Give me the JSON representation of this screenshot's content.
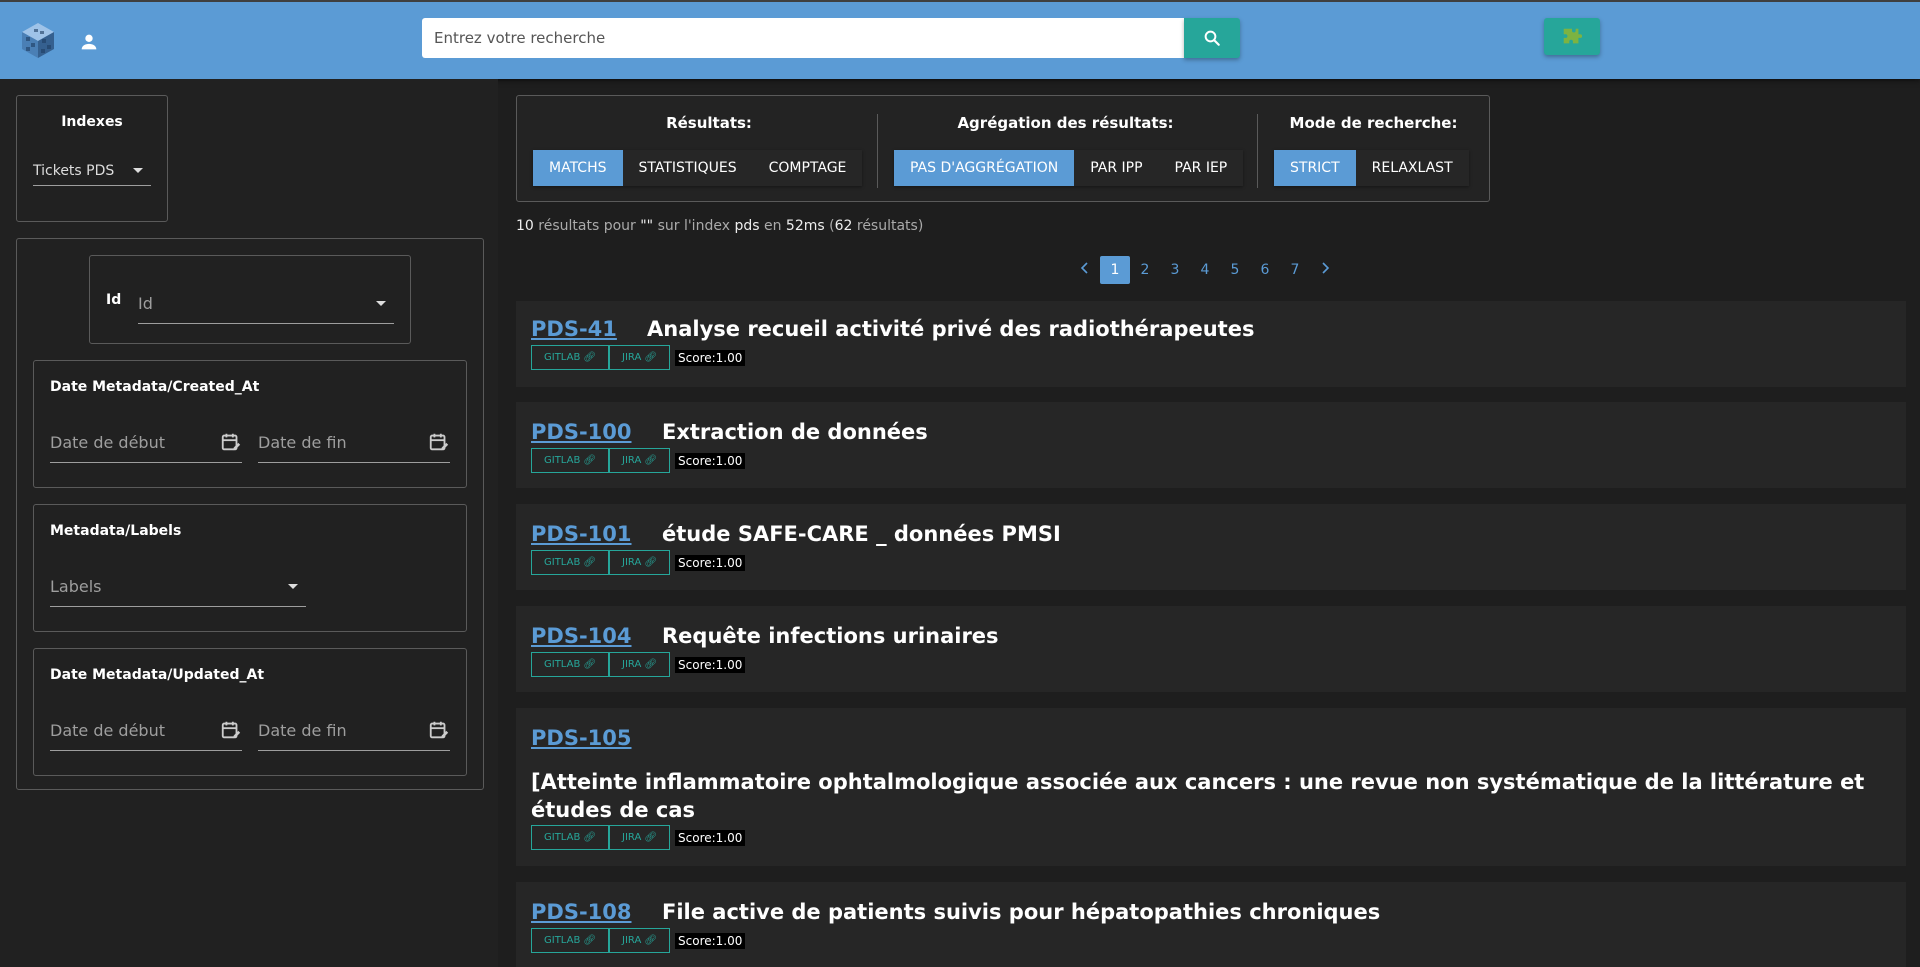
{
  "header": {
    "search_placeholder": "Entrez votre recherche"
  },
  "sidebar": {
    "indexes": {
      "title": "Indexes",
      "selected": "Tickets PDS"
    },
    "id_filter": {
      "label": "Id",
      "placeholder": "Id"
    },
    "created_at": {
      "title": "Date Metadata/Created_At",
      "start": "Date de début",
      "end": "Date de fin"
    },
    "labels": {
      "title": "Metadata/Labels",
      "placeholder": "Labels"
    },
    "updated_at": {
      "title": "Date Metadata/Updated_At",
      "start": "Date de début",
      "end": "Date de fin"
    }
  },
  "modes": {
    "results": {
      "title": "Résultats:",
      "options": [
        "MATCHS",
        "STATISTIQUES",
        "COMPTAGE"
      ]
    },
    "aggregation": {
      "title": "Agrégation des résultats:",
      "options": [
        "PAS D'AGGRÉGATION",
        "PAR IPP",
        "PAR IEP"
      ]
    },
    "search_mode": {
      "title": "Mode de recherche:",
      "options": [
        "STRICT",
        "RELAXLAST"
      ]
    }
  },
  "summary": {
    "count": "10",
    "t1": " résultats pour ",
    "query": "\"\"",
    "t2": " sur l'index ",
    "index": "pds",
    "t3": " en ",
    "time": "52ms",
    "t4": " (",
    "total": "62",
    "t5": " résultats)"
  },
  "pagination": {
    "pages": [
      "1",
      "2",
      "3",
      "4",
      "5",
      "6",
      "7"
    ],
    "current": "1"
  },
  "tags": {
    "gitlab": "GITLAB",
    "jira": "JIRA"
  },
  "results": [
    {
      "id": "PDS-41",
      "title": "Analyse recueil activité privé des radiothérapeutes",
      "score": "Score:1.00"
    },
    {
      "id": "PDS-100",
      "title": "Extraction de données",
      "score": "Score:1.00"
    },
    {
      "id": "PDS-101",
      "title": "étude SAFE-CARE _ données PMSI",
      "score": "Score:1.00"
    },
    {
      "id": "PDS-104",
      "title": "Requête infections urinaires",
      "score": "Score:1.00"
    },
    {
      "id": "PDS-105",
      "title": "[Atteinte inflammatoire ophtalmologique associée aux cancers : une revue non systématique de la littérature et études de cas",
      "score": "Score:1.00"
    },
    {
      "id": "PDS-108",
      "title": "File active de patients suivis pour hépatopathies chroniques",
      "score": "Score:1.00"
    }
  ],
  "colors": {
    "header": "#5b9bd5",
    "accent": "#26a69a",
    "link": "#5b9bd5",
    "background": "#1e1e1e"
  }
}
